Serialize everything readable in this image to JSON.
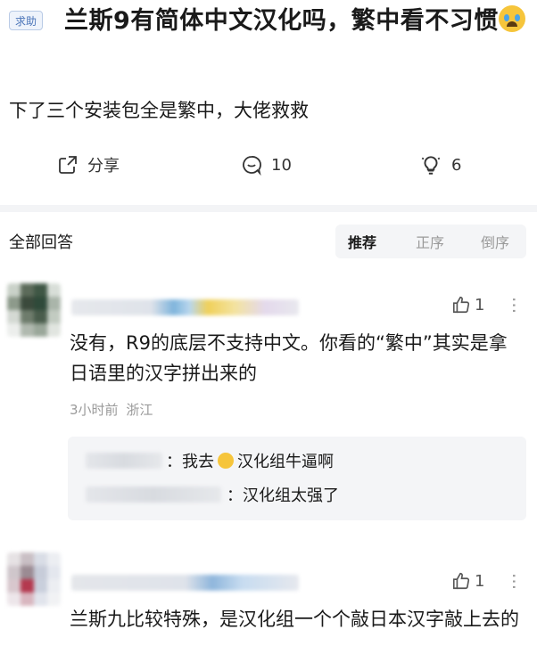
{
  "question": {
    "tag": "求助",
    "title": "兰斯9有简体中文汉化吗，繁中看不习惯",
    "emoji_icon": "loudly-crying-face-icon",
    "description": "下了三个安装包全是繁中，大佬救救"
  },
  "actions": {
    "share_label": "分享",
    "comment_count": "10",
    "idea_count": "6"
  },
  "answers_header": {
    "title": "全部回答",
    "sort_options": [
      "推荐",
      "正序",
      "倒序"
    ],
    "active_sort": "推荐"
  },
  "answers": [
    {
      "likes": "1",
      "text": "没有，R9的底层不支持中文。你看的“繁中”其实是拿日语里的汉字拼出来的",
      "time": "3小时前",
      "location": "浙江",
      "replies": [
        {
          "before_emoji": "：我去",
          "emoji_icon": "smirking-face-icon",
          "after_emoji": "汉化组牛逼啊"
        },
        {
          "before_emoji": "：汉化组太强了",
          "emoji_icon": "",
          "after_emoji": ""
        }
      ]
    },
    {
      "likes": "1",
      "text": "兰斯九比较特殊，是汉化组一个个敲日本汉字敲上去的"
    }
  ],
  "colors": {
    "tag_blue": "#4a74b8",
    "muted": "#9a9a9a",
    "panel_bg": "#f4f5f7"
  }
}
